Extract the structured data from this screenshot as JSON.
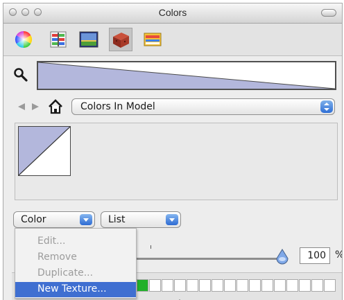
{
  "window": {
    "title": "Colors"
  },
  "toolbar": {
    "items": [
      {
        "name": "color-wheel-icon"
      },
      {
        "name": "color-sliders-icon"
      },
      {
        "name": "color-palettes-icon"
      },
      {
        "name": "image-palettes-icon"
      },
      {
        "name": "crayons-icon"
      }
    ],
    "selected_index": 3
  },
  "nav": {
    "collection": "Colors In Model"
  },
  "buttons": {
    "color_label": "Color",
    "list_label": "List"
  },
  "menu": {
    "items": [
      {
        "label": "Edit...",
        "enabled": false
      },
      {
        "label": "Remove",
        "enabled": false
      },
      {
        "label": "Duplicate...",
        "enabled": false
      },
      {
        "label": "New Texture...",
        "enabled": true,
        "highlighted": true
      }
    ]
  },
  "opacity": {
    "value": "100",
    "unit": "%",
    "level": 1.0
  },
  "colors": {
    "swatch": "#b3b7dc",
    "accent": "#3f6fd1",
    "selected_cell": "#22b02a"
  }
}
